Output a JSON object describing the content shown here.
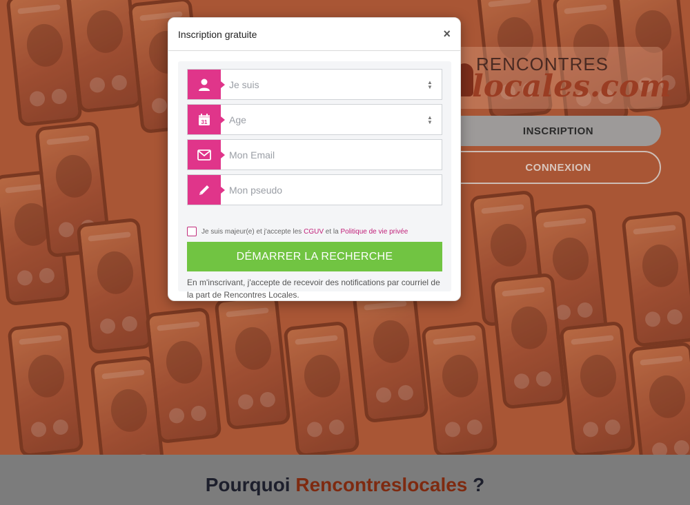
{
  "brand": {
    "line1": "RENCONTRES",
    "line2": "locales.com"
  },
  "nav": {
    "inscription_label": "INSCRIPTION",
    "connexion_label": "CONNEXION"
  },
  "why": {
    "prefix": "Pourquoi",
    "accent": "Rencontreslocales",
    "suffix": "?"
  },
  "modal": {
    "title": "Inscription gratuite",
    "close_label": "×",
    "fields": {
      "gender": {
        "placeholder": "Je suis",
        "icon": "user-icon"
      },
      "age": {
        "placeholder": "Age",
        "icon": "calendar-icon",
        "calendar_day": "31"
      },
      "email": {
        "placeholder": "Mon Email",
        "icon": "envelope-icon"
      },
      "pseudo": {
        "placeholder": "Mon pseudo",
        "icon": "pencil-icon"
      }
    },
    "consent": {
      "text_before": "Je suis majeur(e) et j'accepte les",
      "cguv_link": "CGUV",
      "text_mid": "et la",
      "privacy_link": "Politique de vie privée",
      "checked": false
    },
    "cta_label": "DÉMARRER LA RECHERCHE",
    "notice": "En m'inscrivant, j'accepte de recevoir des notifications par courriel de la part de Rencontres Locales."
  },
  "colors": {
    "accent_pink": "#e0358a",
    "cta_green": "#71c442",
    "brand_rust": "#9a3d23"
  }
}
